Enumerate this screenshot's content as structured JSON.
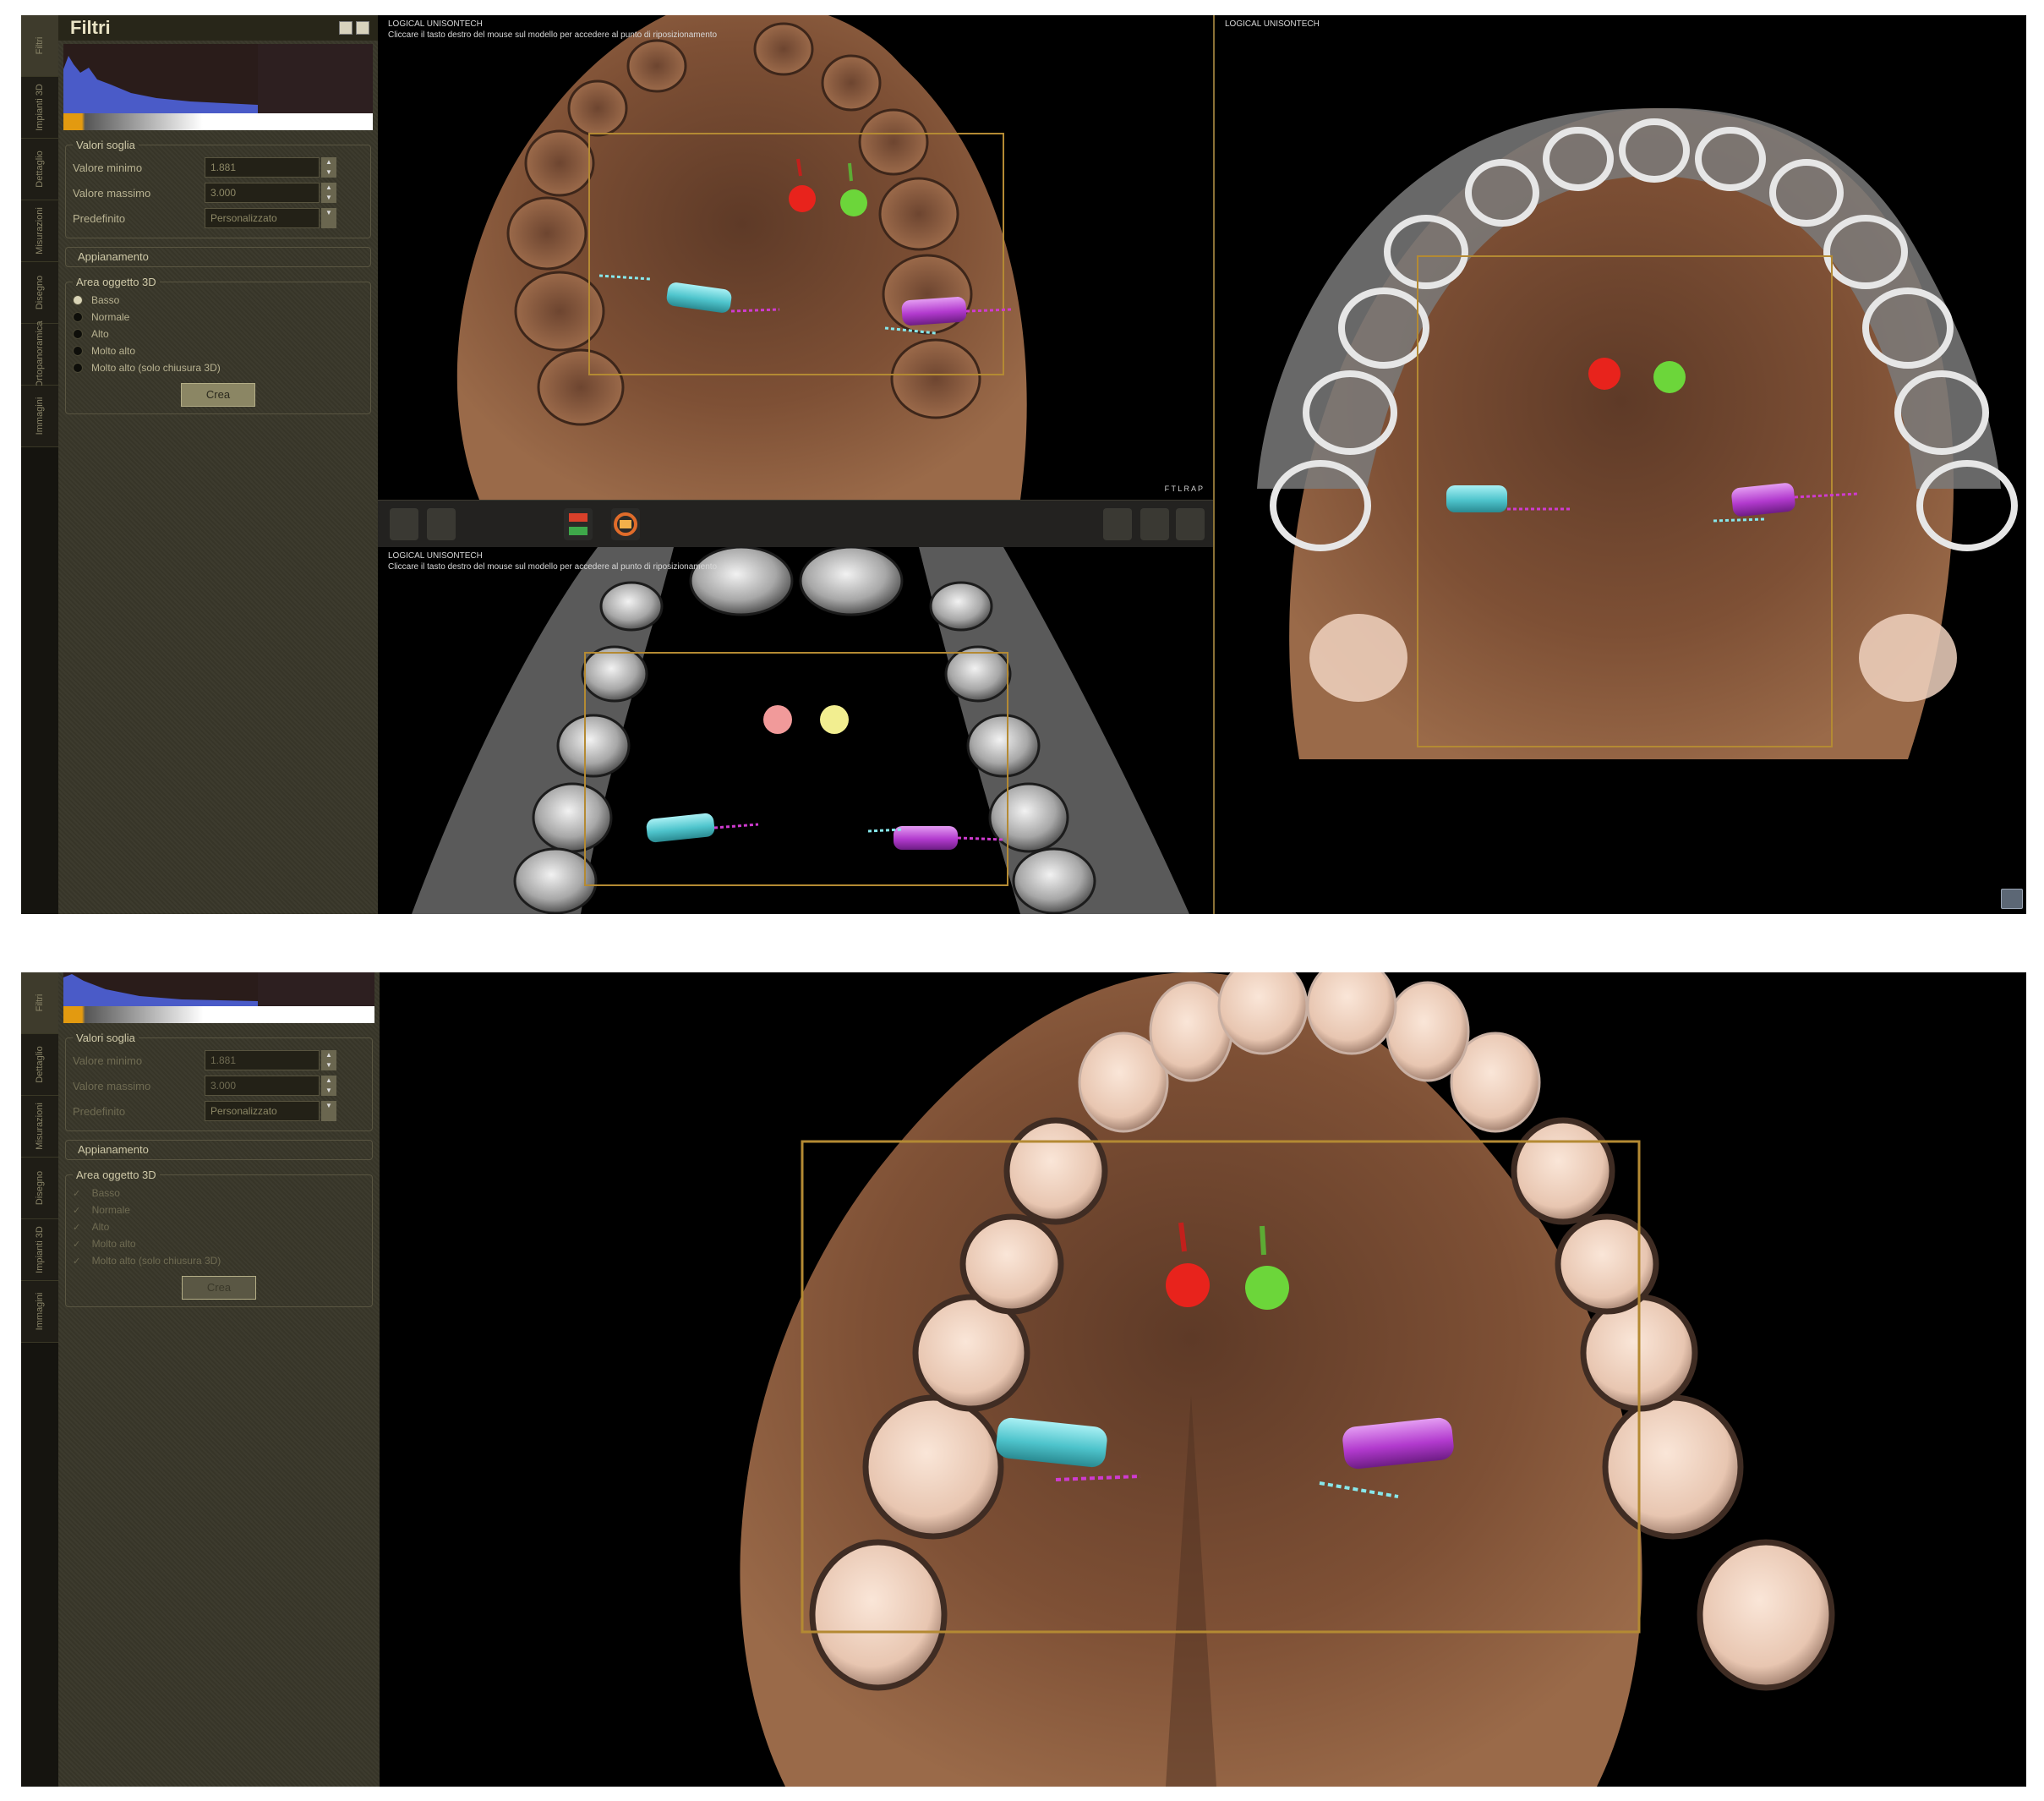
{
  "top": {
    "tabs": [
      "Filtri",
      "Impianti 3D",
      "Dettaglio",
      "Misurazioni",
      "Disegno",
      "Ortopanoramica",
      "Immagini"
    ],
    "panel": {
      "title": "Filtri",
      "threshold_legend": "Valori soglia",
      "min_label": "Valore minimo",
      "min_value": "1.881",
      "max_label": "Valore massimo",
      "max_value": "3.000",
      "preset_label": "Predefinito",
      "preset_value": "Personalizzato",
      "smooth_label": "Appianamento",
      "quality_legend": "Area oggetto 3D",
      "options": [
        "Basso",
        "Normale",
        "Alto",
        "Molto alto",
        "Molto alto (solo chiusura 3D)"
      ],
      "ok_label": "Crea"
    },
    "viewport_a": {
      "caption1": "LOGICAL UNISONTECH",
      "caption2": "Cliccare il tasto destro del mouse sul modello per accedere al punto di riposizionamento",
      "corner_label": "F T L R A P"
    },
    "viewport_b": {
      "caption1": "LOGICAL UNISONTECH",
      "caption2": "Cliccare il tasto destro del mouse sul modello per accedere al punto di riposizionamento"
    },
    "viewport_c": {
      "caption1": "LOGICAL UNISONTECH"
    }
  },
  "bottom": {
    "tabs": [
      "Filtri",
      "Dettaglio",
      "Misurazioni",
      "Disegno",
      "Impianti 3D",
      "Immagini"
    ],
    "panel": {
      "threshold_legend": "Valori soglia",
      "min_label": "Valore minimo",
      "min_value": "1.881",
      "max_label": "Valore massimo",
      "max_value": "3.000",
      "preset_label": "Predefinito",
      "preset_value": "Personalizzato",
      "smooth_label": "Appianamento",
      "quality_legend": "Area oggetto 3D",
      "options": [
        "Basso",
        "Normale",
        "Alto",
        "Molto alto",
        "Molto alto (solo chiusura 3D)"
      ],
      "ok_label": "Crea"
    }
  },
  "colors": {
    "panel_bg": "#39372a",
    "bone": "#8a5a3c",
    "tooth_crown": "#efd7c6",
    "marker_red": "#e8231c",
    "marker_green": "#6cd63a",
    "marker_pink": "#f19a9a",
    "marker_yellow": "#f2ee90",
    "implant_cyan": "#5fd0d6",
    "implant_magenta": "#b63bd0",
    "roi_frame": "#b48a33"
  }
}
